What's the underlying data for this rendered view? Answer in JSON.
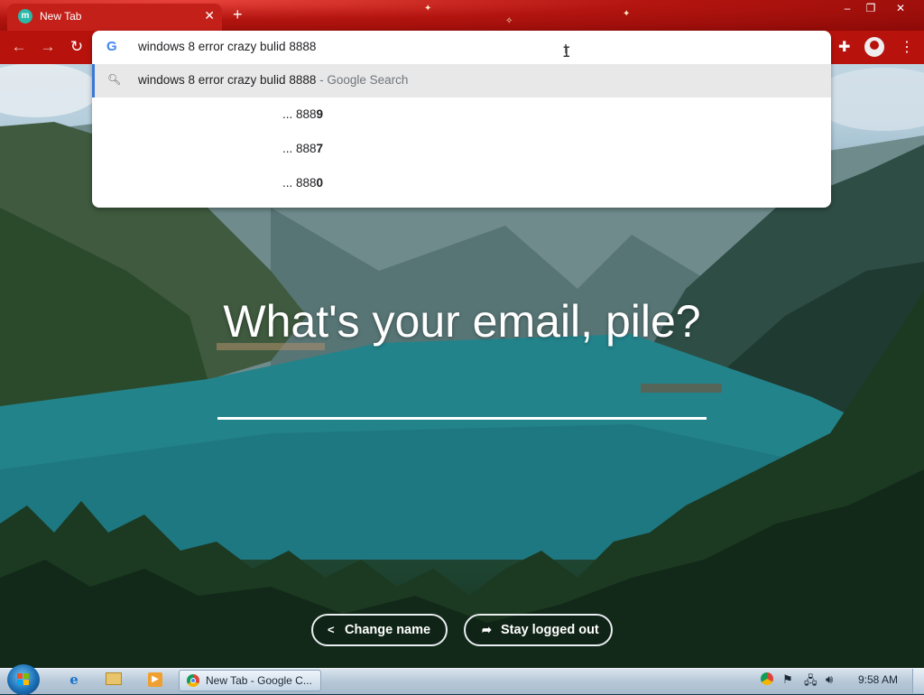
{
  "browser": {
    "tab_title": "New Tab",
    "tab_favicon_letter": "m",
    "new_tab_symbol": "+",
    "window_controls": {
      "minimize": "–",
      "restore": "❐",
      "close": "✕"
    },
    "accent_color": "#b8120d"
  },
  "omnibox": {
    "query": "windows 8 error crazy bulid 8888",
    "suggestions": [
      {
        "text": "windows 8 error crazy bulid 8888",
        "suffix": " - Google Search",
        "selected": true
      },
      {
        "prefix": "... 888",
        "bold": "9"
      },
      {
        "prefix": "... 888",
        "bold": "7"
      },
      {
        "prefix": "... 888",
        "bold": "0"
      }
    ]
  },
  "main": {
    "prompt": "What's your email, pile?",
    "change_name_label": "Change name",
    "stay_logged_out_label": "Stay logged out"
  },
  "taskbar": {
    "task_label": "New Tab - Google C...",
    "clock": "9:58 AM"
  },
  "icons": [
    "back-icon",
    "forward-icon",
    "reload-icon",
    "google-g-icon",
    "search-icon",
    "extensions-icon",
    "profile-icon",
    "menu-icon",
    "text-cursor-icon",
    "start-orb-icon",
    "ie-icon",
    "explorer-icon",
    "media-player-icon",
    "chrome-icon",
    "flag-icon",
    "network-icon",
    "volume-icon"
  ]
}
